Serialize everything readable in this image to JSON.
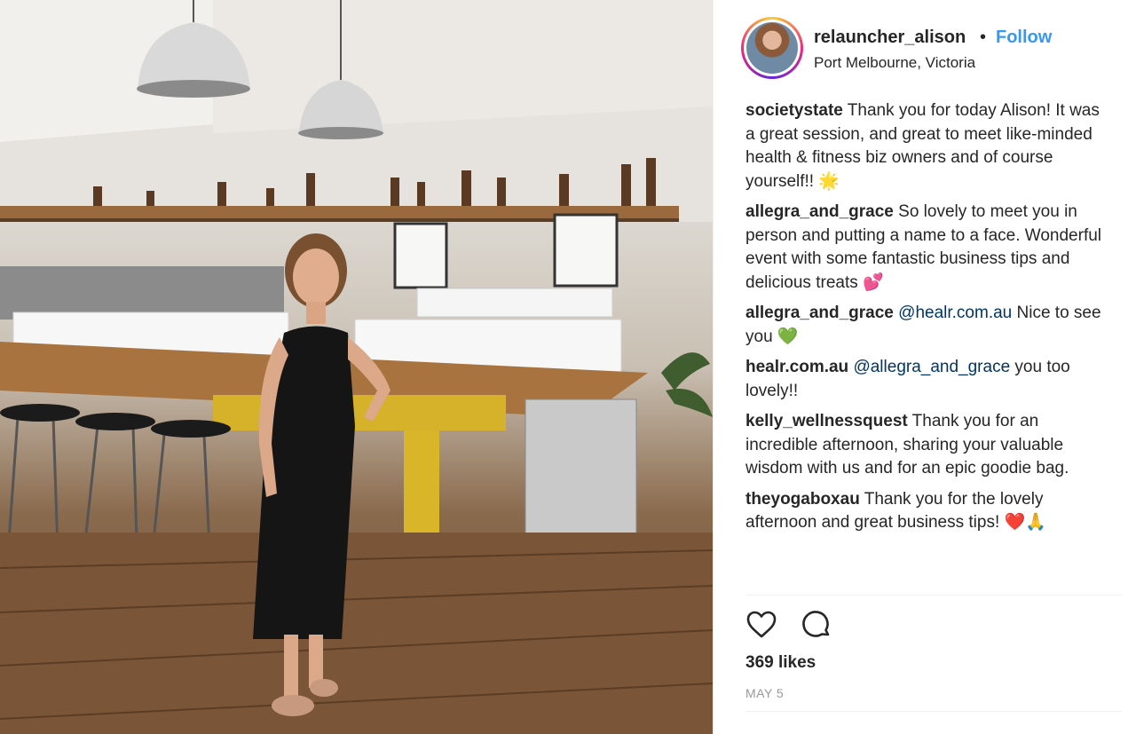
{
  "post": {
    "username": "relauncher_alison",
    "separator": "•",
    "follow_label": "Follow",
    "location": "Port Melbourne, Victoria",
    "photo_icon": "post-photo",
    "avatar_icon": "profile-avatar"
  },
  "comments": [
    {
      "author": "societystate",
      "text": " Thank you for today Alison! It was a great session, and great to meet like-minded health & fitness biz owners and of course yourself!! 🌟"
    },
    {
      "author": "allegra_and_grace",
      "text": " So lovely to meet you in person and putting a name to a face. Wonderful event with some fantastic business tips and delicious treats 💕"
    },
    {
      "author": "allegra_and_grace",
      "mention": "@healr.com.au",
      "text": " Nice to see you 💚"
    },
    {
      "author": "healr.com.au",
      "mention": "@allegra_and_grace",
      "text": " you too lovely!!"
    },
    {
      "author": "kelly_wellnessquest",
      "text": " Thank you for an incredible afternoon, sharing your valuable wisdom with us and for an epic goodie bag."
    },
    {
      "author": "theyogaboxau",
      "text": " Thank you for the lovely afternoon and great business tips! ❤️🙏"
    }
  ],
  "actions": {
    "like_icon": "heart-icon",
    "comment_icon": "comment-icon"
  },
  "likes": "369 likes",
  "date": "MAY 5",
  "colors": {
    "accent": "#3897f0",
    "text": "#262626",
    "muted": "#999999",
    "mention": "#003569",
    "divider": "#efefef"
  }
}
